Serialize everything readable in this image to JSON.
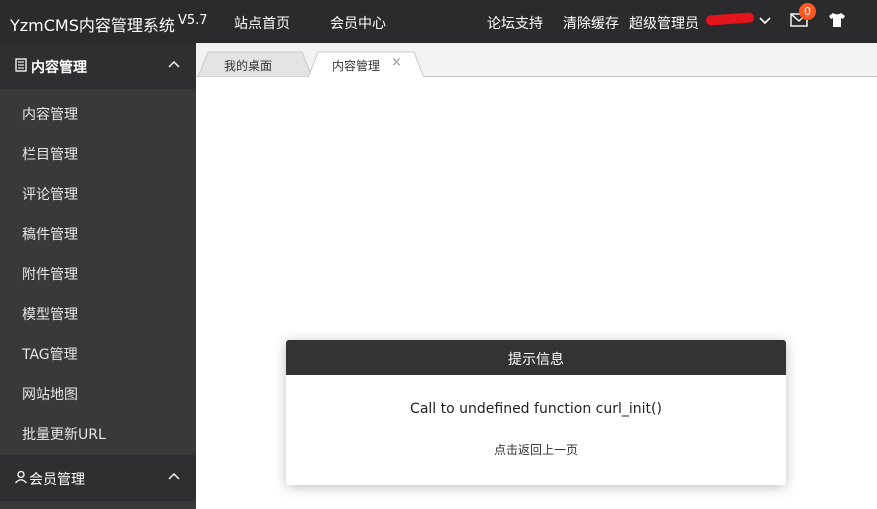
{
  "app": {
    "title": "YzmCMS内容管理系统",
    "version": "V5.7"
  },
  "topnav": {
    "home": "站点首页",
    "member_center": "会员中心",
    "forum": "论坛支持",
    "clear_cache": "清除缓存",
    "admin": "超级管理员",
    "message_count": "0"
  },
  "sidebar": {
    "content_group": "内容管理",
    "items": [
      "内容管理",
      "栏目管理",
      "评论管理",
      "稿件管理",
      "附件管理",
      "模型管理",
      "TAG管理",
      "网站地图",
      "批量更新URL"
    ],
    "member_group": "会员管理"
  },
  "tabs": [
    {
      "label": "我的桌面",
      "active": false
    },
    {
      "label": "内容管理",
      "active": true,
      "close": "×"
    }
  ],
  "dialog": {
    "title": "提示信息",
    "message": "Call to undefined function curl_init()",
    "back_link": "点击返回上一页"
  },
  "colors": {
    "topbar": "#2b2b2d",
    "sidebar": "#393939",
    "sidebar_group": "#2f2f31",
    "dialog_header": "#333333",
    "badge": "#ff5722",
    "redaction": "#e3141c"
  }
}
